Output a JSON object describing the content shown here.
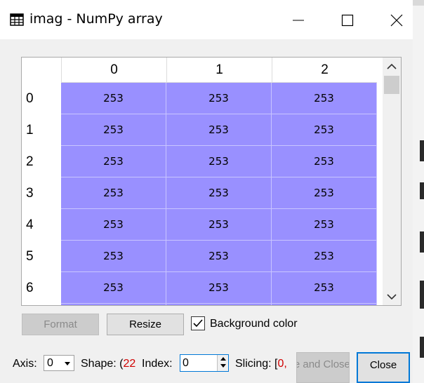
{
  "window": {
    "title": "imag - NumPy array",
    "icon": "table-icon",
    "controls": [
      "minimize-icon",
      "maximize-icon",
      "close-icon"
    ]
  },
  "table": {
    "columns": [
      "0",
      "1",
      "2"
    ],
    "rows": [
      {
        "label": "0",
        "cells": [
          "253",
          "253",
          "253"
        ]
      },
      {
        "label": "1",
        "cells": [
          "253",
          "253",
          "253"
        ]
      },
      {
        "label": "2",
        "cells": [
          "253",
          "253",
          "253"
        ]
      },
      {
        "label": "3",
        "cells": [
          "253",
          "253",
          "253"
        ]
      },
      {
        "label": "4",
        "cells": [
          "253",
          "253",
          "253"
        ]
      },
      {
        "label": "5",
        "cells": [
          "253",
          "253",
          "253"
        ]
      },
      {
        "label": "6",
        "cells": [
          "253",
          "253",
          "253"
        ]
      }
    ],
    "cell_color": "#9990ff"
  },
  "toolbar": {
    "format_label": "Format",
    "resize_label": "Resize",
    "background_color_label": "Background color",
    "background_color_checked": true
  },
  "bottom": {
    "axis_label": "Axis:",
    "axis_value": "0",
    "shape_label": "Shape: (",
    "shape_value": "22",
    "index_label": "Index:",
    "index_value": "0",
    "slicing_label": "Slicing: [",
    "slicing_value": "0,",
    "save_close_label": "Save and Close",
    "close_label": "Close"
  }
}
